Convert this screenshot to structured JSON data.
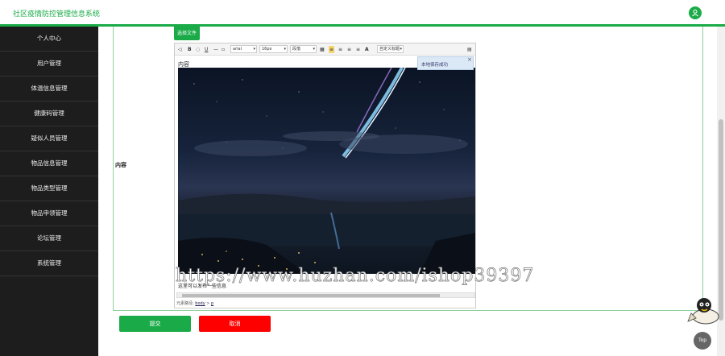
{
  "header": {
    "app_title": "社区疫情防控管理信息系统"
  },
  "sidebar": {
    "items": [
      {
        "label": "个人中心"
      },
      {
        "label": "用户管理"
      },
      {
        "label": "体温信息管理"
      },
      {
        "label": "健康码管理"
      },
      {
        "label": "疑似人员管理"
      },
      {
        "label": "物品信息管理"
      },
      {
        "label": "物品类型管理"
      },
      {
        "label": "物品申领管理"
      },
      {
        "label": "论坛管理"
      },
      {
        "label": "系统管理"
      }
    ]
  },
  "form": {
    "field_label": "内容",
    "choose_file_label": "选择文件",
    "submit_label": "提交",
    "cancel_label": "取消"
  },
  "editor": {
    "toolbar": {
      "bold": "B",
      "underline": "U",
      "font_family": "arial",
      "font_size": "16px",
      "paragraph": "段落",
      "font_color": "A",
      "custom_title": "自定义标题"
    },
    "content_label": "内容",
    "caption": "这里可以发布一些信息",
    "status_path_label": "元素路径:",
    "status_path_items": [
      "body",
      "p"
    ],
    "save_tip": "本地保存成功",
    "save_tip_close": "×"
  },
  "watermark": "https://www.huzhan.com/ishop39397",
  "top_button": "Top",
  "colors": {
    "accent": "#1aab48",
    "danger": "#ff0000",
    "sidebar_bg": "#1d1d1d"
  }
}
